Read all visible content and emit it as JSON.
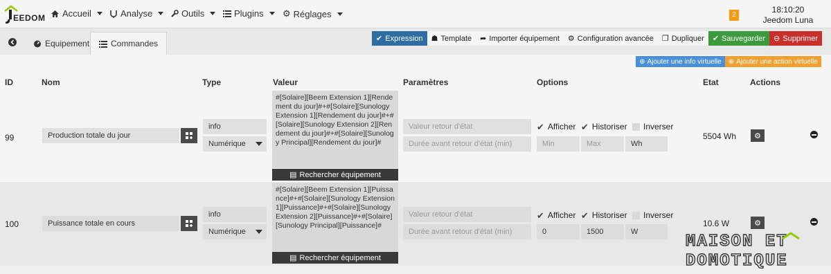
{
  "navbar": {
    "logo_text": "EEDOM",
    "menu": [
      {
        "label": "Accueil",
        "icon": "home-icon"
      },
      {
        "label": "Analyse",
        "icon": "analyse-icon"
      },
      {
        "label": "Outils",
        "icon": "wrench-icon"
      },
      {
        "label": "Plugins",
        "icon": "list-icon"
      },
      {
        "label": "Réglages",
        "icon": "gear-icon"
      }
    ],
    "notification_count": "2",
    "time": "18:10:20",
    "system_name": "Jeedom Luna"
  },
  "tabs": {
    "equipement": "Equipement",
    "commandes": "Commandes"
  },
  "toolbar": {
    "expression": "Expression",
    "template": "Template",
    "importer": "Importer équipement",
    "config": "Configuration avancée",
    "dupliquer": "Dupliquer",
    "sauvegarder": "Sauvegarder",
    "supprimer": "Supprimer"
  },
  "virtual_buttons": {
    "add_info": "Ajouter une info virtuelle",
    "add_action": "Ajouter une action virtuelle"
  },
  "table": {
    "headers": {
      "id": "ID",
      "nom": "Nom",
      "type": "Type",
      "valeur": "Valeur",
      "parametres": "Paramètres",
      "options": "Options",
      "etat": "Etat",
      "actions": "Actions"
    },
    "rows": [
      {
        "id": "99",
        "nom": "Production totale du jour",
        "type": "info",
        "subtype": "Numérique",
        "valeur": "#[Solaire][Beem Extension 1][Rendement du jour]#+#[Solaire][Sunology Extension 1][Rendement du jour]#+#[Solaire][Sunology Extension 2][Rendement du jour]#+#[Solaire][Sunology Principal][Rendement du jour]#",
        "search_label": "Rechercher équipement",
        "retour_etat_placeholder": "Valeur retour d'état",
        "duree_placeholder": "Durée avant retour d'état (min)",
        "afficher": "Afficher",
        "historiser": "Historiser",
        "inverser": "Inverser",
        "min": "Min",
        "max": "Max",
        "unit": "Wh",
        "min_is_placeholder": true,
        "max_is_placeholder": true,
        "etat": "5504 Wh"
      },
      {
        "id": "100",
        "nom": "Puissance totale en cours",
        "type": "info",
        "subtype": "Numérique",
        "valeur": "#[Solaire][Beem Extension 1][Puissance]#+#[Solaire][Sunology Extension 1][Puissance]#+#[Solaire][Sunology Extension 2][Puissance]#+#[Solaire][Sunology Principal][Puissance]#",
        "search_label": "Rechercher équipement",
        "retour_etat_placeholder": "Valeur retour d'état",
        "duree_placeholder": "Durée avant retour d'état (min)",
        "afficher": "Afficher",
        "historiser": "Historiser",
        "inverser": "Inverser",
        "min": "0",
        "max": "1500",
        "unit": "W",
        "min_is_placeholder": false,
        "max_is_placeholder": false,
        "etat": "10.6 W"
      }
    ]
  },
  "watermark": {
    "line1": "MAISON ET",
    "line2": "DOMOTIQUE"
  },
  "colors": {
    "expression_bg": "#2e6da4",
    "save_bg": "#3c9a3c",
    "delete_bg": "#c9302c",
    "badge_bg": "#f39c12",
    "add_info_bg": "#4a90d9",
    "add_action_bg": "#f0a030"
  }
}
